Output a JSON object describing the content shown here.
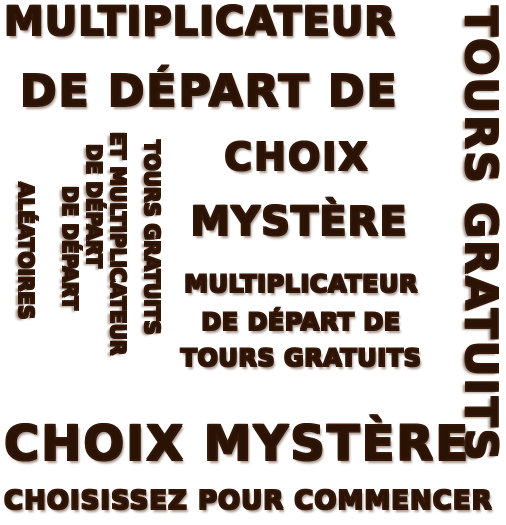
{
  "header": {
    "line1": "Multiplicateur",
    "line2": "de départ de"
  },
  "mystery_title": {
    "line1": "Choix",
    "line2": "Mystère"
  },
  "free_spins_multiplier": {
    "line1": "Multiplicateur",
    "line2": "de départ de",
    "line3": "Tours Gratuits"
  },
  "side_label": "Tours Gratuits",
  "columns": {
    "col1": "Tours Gratuits",
    "col2a": "et Multiplicateur",
    "col2b": "de départ",
    "col3a": "de départ",
    "col3b": "aléatoires"
  },
  "bottom": {
    "title": "Choix Mystère",
    "prompt": "Choisissez pour commencer"
  }
}
